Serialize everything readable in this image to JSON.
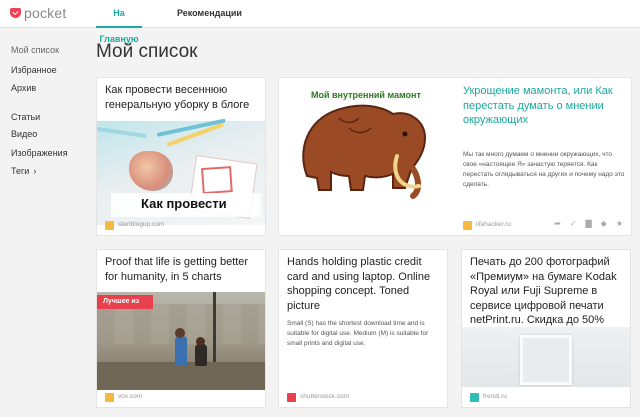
{
  "app": {
    "logo_text": "pocket"
  },
  "nav": {
    "tabs": [
      {
        "label": "На Главную",
        "active": true
      },
      {
        "label": "Рекомендации",
        "active": false
      }
    ]
  },
  "sidebar": {
    "items": [
      {
        "label": "Мой список",
        "active": true
      },
      {
        "label": "Избранное"
      },
      {
        "label": "Архив"
      },
      {
        "label": "Статьи"
      },
      {
        "label": "Видео"
      },
      {
        "label": "Изображения"
      },
      {
        "label": "Теги"
      }
    ],
    "tags_chevron": "›"
  },
  "main": {
    "title": "Мой список",
    "cards": [
      {
        "title": "Как провести весеннюю генеральную уборку в блоге",
        "image_overlay_text": "Как провести",
        "domain": "startblogup.com",
        "favicon_color": "#f5b942"
      },
      {
        "image_title": "Мой внутренний мамонт",
        "title": "Укрощение мамонта, или Как перестать думать о мнении окружающих",
        "excerpt": "Мы так много думаем о мнении окружающих, что свое «настоящее Я» зачастую теряется. Как перестать оглядываться на других и почему надо это сделать.",
        "domain": "lifehacker.ru",
        "favicon_color": "#f5b942",
        "actions": [
          "share-icon",
          "check-icon",
          "trash-icon",
          "tag-icon",
          "star-icon"
        ]
      },
      {
        "title": "Proof that life is getting better for humanity, in 5 charts",
        "badge": "Лучшее из",
        "domain": "vox.com",
        "favicon_color": "#f5b942"
      },
      {
        "title": "Hands holding plastic credit card and using laptop. Online shopping concept. Toned picture",
        "excerpt": "Small (S) has the shortest download time and is suitable for digital use. Medium (M) is suitable for small prints and digital use.",
        "domain": "shutterstock.com",
        "favicon_color": "#e8404d"
      },
      {
        "title": "Печать до 200 фотографий «Премиум» на бумаге Kodak Royal или Fuji Supreme в сервисе цифровой печати netPrint.ru. Скидка до 50%",
        "domain": "frendi.ru",
        "favicon_color": "#2fbcb6"
      }
    ]
  },
  "colors": {
    "accent": "#1ba8a0",
    "brand": "#ef4056",
    "badge": "#e8404d"
  }
}
